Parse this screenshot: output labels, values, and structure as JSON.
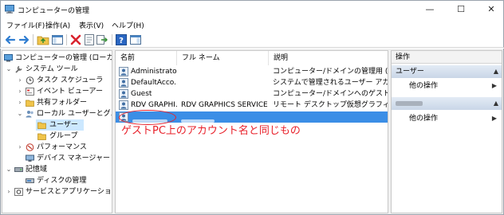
{
  "window": {
    "title": "コンピューターの管理",
    "minimize_glyph": "—",
    "maximize_glyph": "☐",
    "close_glyph": "✕"
  },
  "menu": {
    "items": [
      "ファイル(F)",
      "操作(A)",
      "表示(V)",
      "ヘルプ(H)"
    ]
  },
  "toolbar": {
    "icons": [
      "back-icon",
      "forward-icon",
      "up-folder-icon",
      "show-hide-tree-icon",
      "delete-icon",
      "properties-icon",
      "export-icon",
      "help-icon",
      "show-hide-action-icon"
    ]
  },
  "tree": {
    "items": [
      {
        "label": "コンピューターの管理 (ローカル)",
        "icon": "computer-management-icon",
        "expander": ""
      },
      {
        "label": "システム ツール",
        "icon": "system-tools-icon",
        "expander": "⌄"
      },
      {
        "label": "タスク スケジューラ",
        "icon": "task-scheduler-icon",
        "expander": "›"
      },
      {
        "label": "イベント ビューアー",
        "icon": "event-viewer-icon",
        "expander": "›"
      },
      {
        "label": "共有フォルダー",
        "icon": "shared-folders-icon",
        "expander": "›"
      },
      {
        "label": "ローカル ユーザーとグループ",
        "icon": "local-users-groups-icon",
        "expander": "⌄"
      },
      {
        "label": "ユーザー",
        "icon": "folder-icon",
        "expander": ""
      },
      {
        "label": "グループ",
        "icon": "folder-icon",
        "expander": ""
      },
      {
        "label": "パフォーマンス",
        "icon": "performance-icon",
        "expander": "›"
      },
      {
        "label": "デバイス マネージャー",
        "icon": "device-manager-icon",
        "expander": ""
      },
      {
        "label": "記憶域",
        "icon": "storage-icon",
        "expander": "⌄"
      },
      {
        "label": "ディスクの管理",
        "icon": "disk-management-icon",
        "expander": ""
      },
      {
        "label": "サービスとアプリケーション",
        "icon": "services-applications-icon",
        "expander": "›"
      }
    ]
  },
  "list": {
    "columns": [
      "名前",
      "フル ネーム",
      "説明"
    ],
    "rows": [
      {
        "name": "Administrator",
        "full_name": "",
        "description": "コンピューター/ドメインの管理用 (ビルトイ..."
      },
      {
        "name": "DefaultAcco...",
        "full_name": "",
        "description": "システムで管理されるユーザー アカウン..."
      },
      {
        "name": "Guest",
        "full_name": "",
        "description": "コンピューター/ドメインへのゲスト アクセ..."
      },
      {
        "name": "RDV GRAPHI...",
        "full_name": "RDV GRAPHICS SERVICE",
        "description": "リモート デスクトップ仮想グラフィックス..."
      }
    ]
  },
  "annotation": {
    "text": "ゲストPC上のアカウント名と同じもの",
    "color": "#e8202a"
  },
  "actions": {
    "title": "操作",
    "sections": [
      {
        "header": "ユーザー",
        "item": "他の操作"
      },
      {
        "header": "",
        "item": "他の操作"
      }
    ]
  }
}
